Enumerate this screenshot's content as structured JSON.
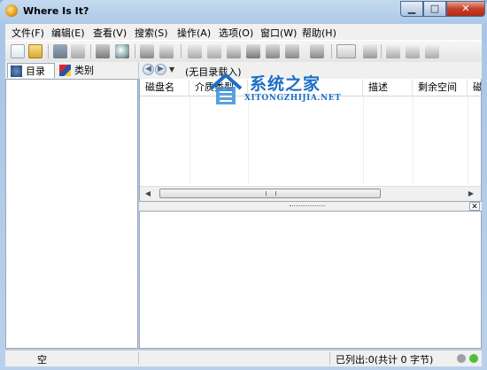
{
  "window": {
    "title": "Where Is It?"
  },
  "window_buttons": {
    "minimize": "▁",
    "maximize": "□",
    "close": "✕"
  },
  "menu": [
    "文件(F)",
    "编辑(E)",
    "查看(V)",
    "搜索(S)",
    "操作(A)",
    "选项(O)",
    "窗口(W)",
    "帮助(H)"
  ],
  "tabs": {
    "catalog": "目录",
    "category": "类别"
  },
  "nav": {
    "label": "(无目录载入)"
  },
  "columns": [
    "磁盘名",
    "介质类型",
    "描述",
    "剩余空间",
    "磁盘"
  ],
  "watermark": {
    "text": "系统之家",
    "sub": "XITONGZHIJIA.NET"
  },
  "status": {
    "left": "空",
    "right": "已列出:0(共计 0 字节)"
  },
  "colors": {
    "led_green": "#4fbf3a",
    "led_gray": "#9aa0a6"
  }
}
